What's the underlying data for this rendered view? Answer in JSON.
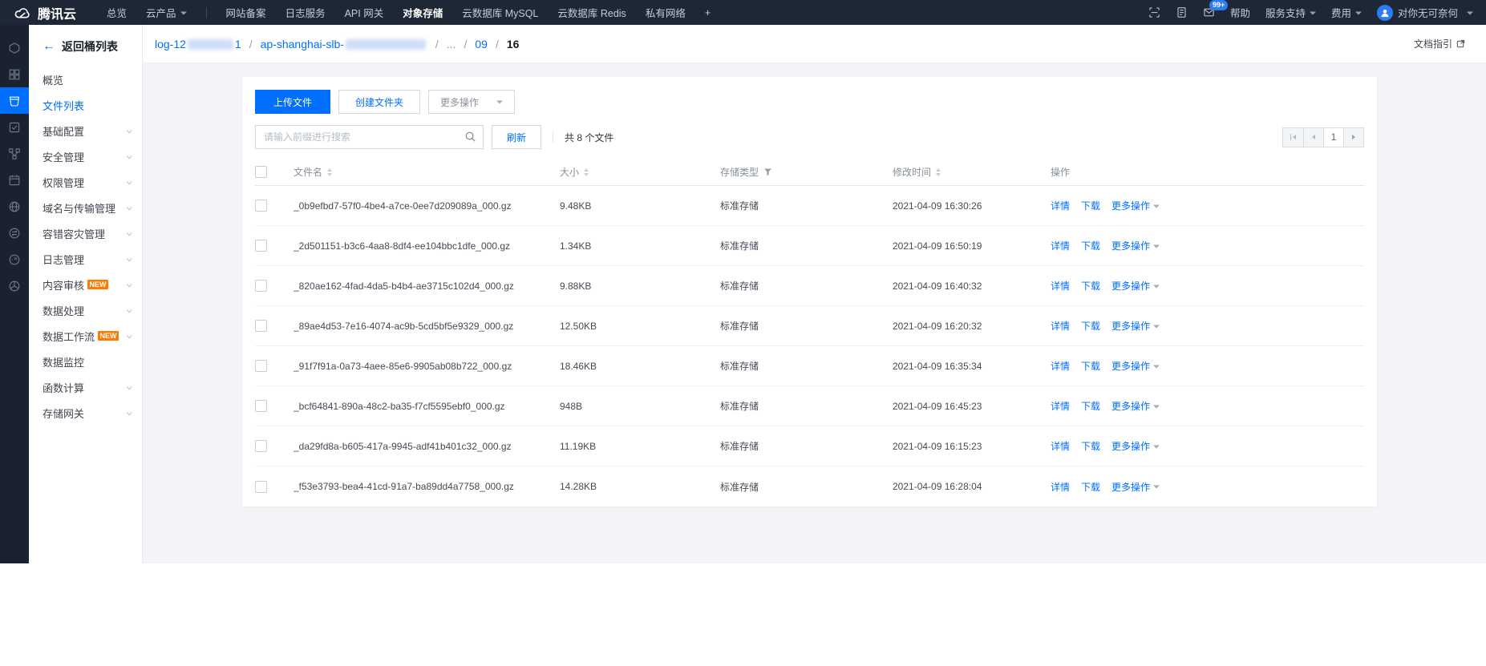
{
  "topbar": {
    "brand": "腾讯云",
    "overview": "总览",
    "products_menu": "云产品",
    "pinned": [
      {
        "label": "网站备案"
      },
      {
        "label": "日志服务"
      },
      {
        "label": "API 网关"
      },
      {
        "label": "对象存储",
        "active": true
      },
      {
        "label": "云数据库 MySQL"
      },
      {
        "label": "云数据库 Redis"
      },
      {
        "label": "私有网络"
      },
      {
        "label": "+",
        "add": true
      }
    ],
    "message_badge": "99+",
    "help": "帮助",
    "support": "服务支持",
    "billing": "费用",
    "user_name": "对你无可奈何"
  },
  "rail": {
    "icons": [
      "cloud-product",
      "dashboard",
      "cos-storage",
      "checklist",
      "topology",
      "calendar",
      "globe",
      "exchange",
      "monitor",
      "pinwheel"
    ],
    "active_index": 2
  },
  "sidebar": {
    "back_label": "返回桶列表",
    "items": [
      {
        "label": "概览"
      },
      {
        "label": "文件列表",
        "active": true
      },
      {
        "label": "基础配置",
        "expandable": true
      },
      {
        "label": "安全管理",
        "expandable": true
      },
      {
        "label": "权限管理",
        "expandable": true
      },
      {
        "label": "域名与传输管理",
        "expandable": true
      },
      {
        "label": "容错容灾管理",
        "expandable": true
      },
      {
        "label": "日志管理",
        "expandable": true
      },
      {
        "label": "内容审核",
        "badge": "NEW",
        "expandable": true
      },
      {
        "label": "数据处理",
        "expandable": true
      },
      {
        "label": "数据工作流",
        "badge": "NEW",
        "expandable": true
      },
      {
        "label": "数据监控"
      },
      {
        "label": "函数计算",
        "expandable": true
      },
      {
        "label": "存储网关",
        "expandable": true
      }
    ]
  },
  "breadcrumb": {
    "segments": [
      {
        "prefix": "log-12",
        "suffix": "1",
        "redacted": true,
        "blur_width": 57,
        "style": "link"
      },
      {
        "prefix": "ap-shanghai-slb-",
        "suffix": "",
        "redacted": true,
        "blur_width": 100,
        "style": "link"
      },
      {
        "prefix": "...",
        "style": "muted"
      },
      {
        "prefix": "09",
        "style": "link"
      },
      {
        "prefix": "16",
        "style": "current"
      }
    ],
    "separator": "/",
    "doc_link": "文档指引"
  },
  "toolbar": {
    "upload": "上传文件",
    "create_folder": "创建文件夹",
    "more_actions": "更多操作",
    "search_placeholder": "请输入前缀进行搜索",
    "refresh": "刷新",
    "file_count": "共 8 个文件",
    "current_page": "1"
  },
  "table": {
    "headers": {
      "name": "文件名",
      "size": "大小",
      "type": "存储类型",
      "time": "修改时间",
      "ops": "操作"
    },
    "row_actions": {
      "detail": "详情",
      "download": "下载",
      "more": "更多操作"
    },
    "rows": [
      {
        "name": "_0b9efbd7-57f0-4be4-a7ce-0ee7d209089a_000.gz",
        "size": "9.48KB",
        "type": "标准存储",
        "time": "2021-04-09 16:30:26"
      },
      {
        "name": "_2d501151-b3c6-4aa8-8df4-ee104bbc1dfe_000.gz",
        "size": "1.34KB",
        "type": "标准存储",
        "time": "2021-04-09 16:50:19"
      },
      {
        "name": "_820ae162-4fad-4da5-b4b4-ae3715c102d4_000.gz",
        "size": "9.88KB",
        "type": "标准存储",
        "time": "2021-04-09 16:40:32"
      },
      {
        "name": "_89ae4d53-7e16-4074-ac9b-5cd5bf5e9329_000.gz",
        "size": "12.50KB",
        "type": "标准存储",
        "time": "2021-04-09 16:20:32"
      },
      {
        "name": "_91f7f91a-0a73-4aee-85e6-9905ab08b722_000.gz",
        "size": "18.46KB",
        "type": "标准存储",
        "time": "2021-04-09 16:35:34"
      },
      {
        "name": "_bcf64841-890a-48c2-ba35-f7cf5595ebf0_000.gz",
        "size": "948B",
        "type": "标准存储",
        "time": "2021-04-09 16:45:23"
      },
      {
        "name": "_da29fd8a-b605-417a-9945-adf41b401c32_000.gz",
        "size": "11.19KB",
        "type": "标准存储",
        "time": "2021-04-09 16:15:23"
      },
      {
        "name": "_f53e3793-bea4-41cd-91a7-ba89dd4a7758_000.gz",
        "size": "14.28KB",
        "type": "标准存储",
        "time": "2021-04-09 16:28:04"
      }
    ]
  },
  "colors": {
    "accent": "#006eff",
    "topbar_bg": "#1e2736",
    "rail_bg": "#1a2230",
    "page_bg": "#f3f4f7",
    "new_badge": "#ff7800",
    "badge_blue": "#2d7cf5"
  }
}
